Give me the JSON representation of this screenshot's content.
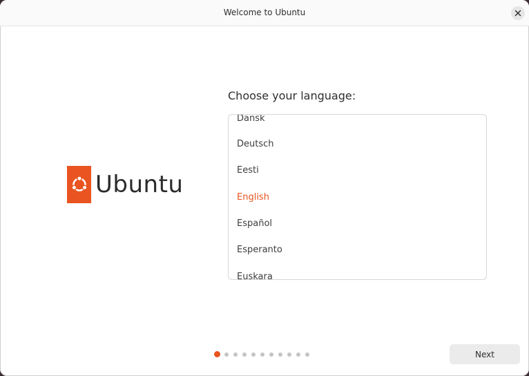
{
  "window": {
    "title": "Welcome to Ubuntu"
  },
  "brand": {
    "name": "Ubuntu",
    "color": "#e95420"
  },
  "language_step": {
    "heading": "Choose your language:",
    "languages": [
      "Dansk",
      "Deutsch",
      "Eesti",
      "English",
      "Español",
      "Esperanto",
      "Euskara"
    ],
    "selected": "English"
  },
  "pagination": {
    "total_steps": 11,
    "current_step": 1
  },
  "buttons": {
    "next_label": "Next"
  },
  "icons": {
    "close": "close-icon",
    "logo": "ubuntu-circle-of-friends-icon"
  },
  "colors": {
    "accent": "#e95420",
    "text": "#3d3d3d",
    "inactive_dot": "#c4c4c4"
  }
}
